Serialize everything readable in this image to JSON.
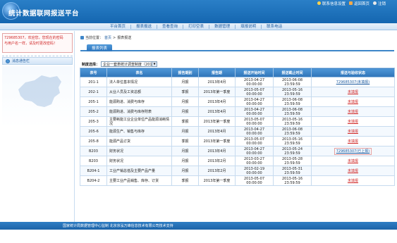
{
  "header": {
    "title": "统计数据联网报送平台",
    "links": [
      {
        "label": "联系信息设置",
        "icon": "settings-icon"
      },
      {
        "label": "返回首页",
        "icon": "home-icon"
      },
      {
        "label": "注销",
        "icon": "logout-icon"
      }
    ]
  },
  "nav": {
    "items": [
      "平台首页",
      "报表报送",
      "查看查询",
      "打印空表",
      "数据管理",
      "填报说明",
      "联系电话"
    ]
  },
  "left": {
    "user_line1": "729685307，欢迎您，您现在的密码",
    "user_line2": "与用户名一样，请及时更改密码！",
    "notice_title": "消息通告栏"
  },
  "breadcrumb": {
    "prefix": "当前位置：",
    "home": "首页",
    "separator": ">",
    "current": "报表报送"
  },
  "tab": {
    "label": "报表列表"
  },
  "filter": {
    "label": "制度选择：",
    "selected": "企业一套表统计调查制度（2013）"
  },
  "table": {
    "headers": [
      "表号",
      "表名",
      "报告期别",
      "报告期",
      "报送开始时间",
      "报送截止时间",
      "报送与验收状态"
    ],
    "rows": [
      {
        "code": "201-1",
        "name": "法人单位基本情况",
        "period_type": "月报",
        "period": "2013年4月",
        "start": "2013-04-27 00:00:00",
        "end": "2013-06-08 23:59:59",
        "status": "729685307(未填报)",
        "status_style": "blue"
      },
      {
        "code": "202-1",
        "name": "从业人员及工资总额",
        "period_type": "季报",
        "period": "2013年第一季度",
        "start": "2013-05-07 00:00:00",
        "end": "2013-05-16 23:59:59",
        "status": "未填报",
        "status_style": "red"
      },
      {
        "code": "205-1",
        "name": "能源购进、消费与库存",
        "period_type": "月报",
        "period": "2013年4月",
        "start": "2013-04-27 00:00:00",
        "end": "2013-06-08 23:59:59",
        "status": "未填报",
        "status_style": "red"
      },
      {
        "code": "205-2",
        "name": "能源购进、消费与库存附表",
        "period_type": "月报",
        "period": "2013年4月",
        "start": "2013-04-27 00:00:00",
        "end": "2013-06-08 23:59:59",
        "status": "未填报",
        "status_style": "red"
      },
      {
        "code": "205-3",
        "name": "主要耗能工业企业单位产品能源消耗情况",
        "period_type": "季报",
        "period": "2013年第一季度",
        "start": "2013-05-07 00:00:00",
        "end": "2013-05-16 23:59:59",
        "status": "未填报",
        "status_style": "red"
      },
      {
        "code": "205-6",
        "name": "能源生产、销售与库存",
        "period_type": "月报",
        "period": "2013年4月",
        "start": "2013-04-27 00:00:00",
        "end": "2013-06-08 23:59:59",
        "status": "未填报",
        "status_style": "red"
      },
      {
        "code": "205-8",
        "name": "能源产品订货",
        "period_type": "季报",
        "period": "2013年第一季度",
        "start": "2013-05-07 00:00:00",
        "end": "2013-05-16 23:59:59",
        "status": "未填报",
        "status_style": "red"
      },
      {
        "code": "B203",
        "name": "财务状况",
        "period_type": "月报",
        "period": "2013年4月",
        "start": "2013-04-27 00:00:00",
        "end": "2013-05-24 23:59:59",
        "status": "729685307(已上报)",
        "status_style": "blue-box"
      },
      {
        "code": "B203",
        "name": "财务状况",
        "period_type": "月报",
        "period": "2013年2月",
        "start": "2013-03-27 00:00:00",
        "end": "2013-05-28 23:59:59",
        "status": "未填报",
        "status_style": "red"
      },
      {
        "code": "B204-1",
        "name": "工业产销总值及主要产品产量",
        "period_type": "月报",
        "period": "2013年2月",
        "start": "2013-02-19 00:00:00",
        "end": "2013-05-31 23:59:59",
        "status": "未填报",
        "status_style": "red"
      },
      {
        "code": "B204-2",
        "name": "主要工业产品销售、库存、订货",
        "period_type": "季报",
        "period": "2013年第一季度",
        "start": "2013-05-07 00:00:00",
        "end": "2013-05-16 23:59:59",
        "status": "未填报",
        "status_style": "red"
      }
    ]
  },
  "footer": {
    "text": "国家统计局数据管理中心监制  北京京泓万峰信息技术有限公司技术支持"
  },
  "colors": {
    "header_blue": "#1a6cb5",
    "status_red": "#d12b2b",
    "link_blue": "#1f5da1"
  }
}
